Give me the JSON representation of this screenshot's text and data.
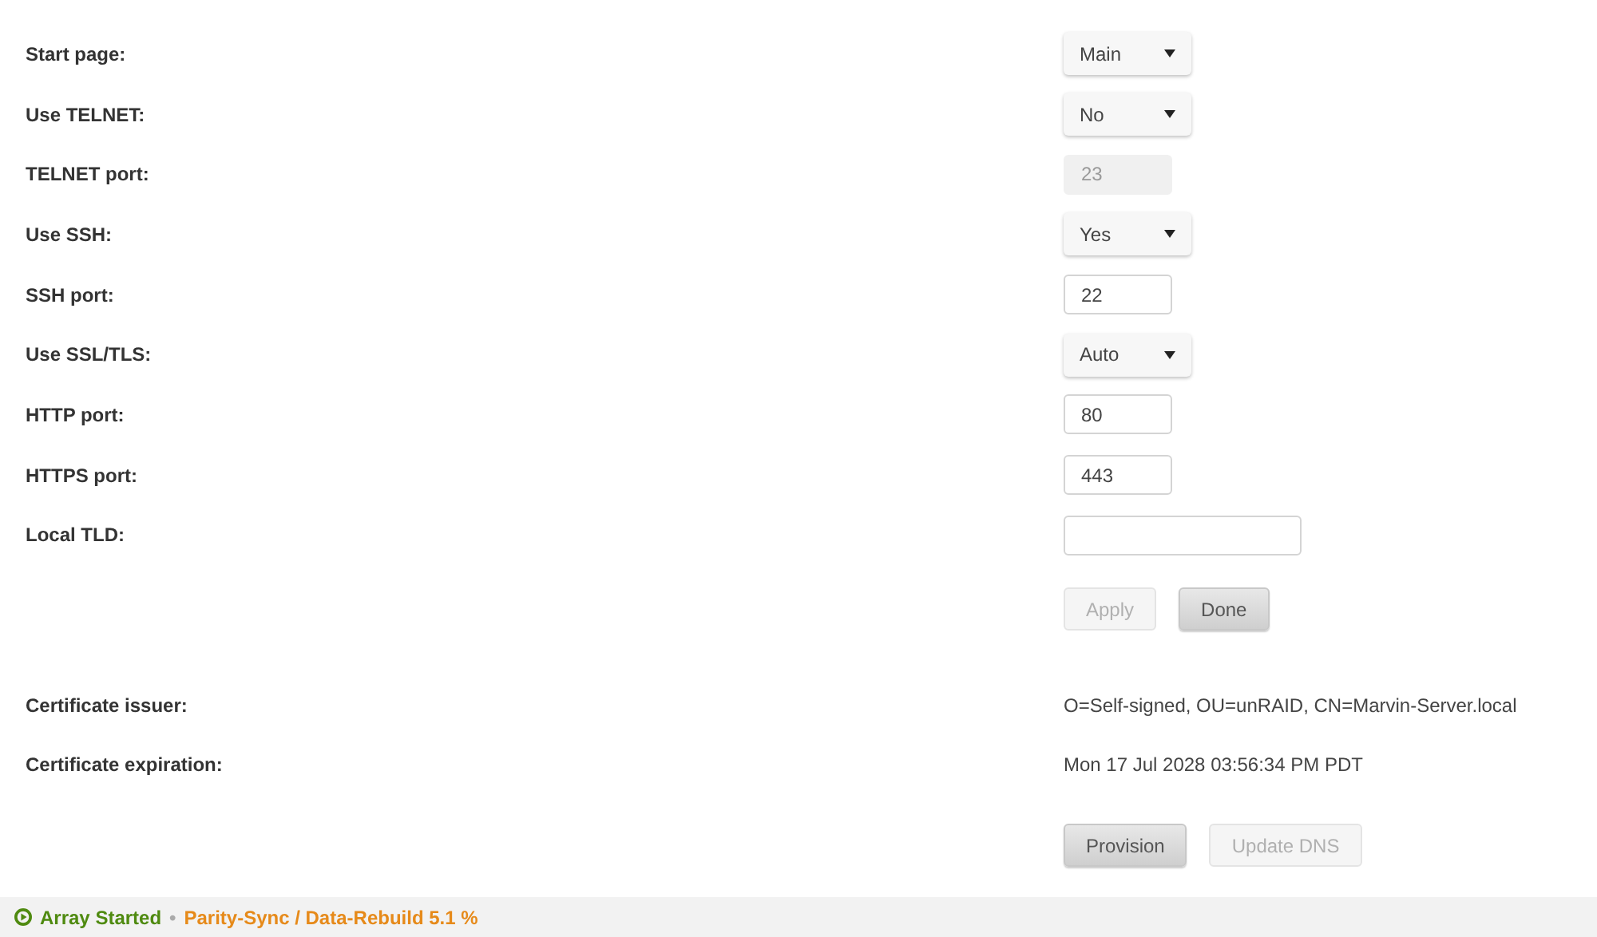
{
  "settings": [
    {
      "label": "Start page:",
      "kind": "select",
      "value": "Main"
    },
    {
      "label": "Use TELNET:",
      "kind": "select",
      "value": "No"
    },
    {
      "label": "TELNET port:",
      "kind": "input",
      "value": "23",
      "disabled": true
    },
    {
      "label": "Use SSH:",
      "kind": "select",
      "value": "Yes"
    },
    {
      "label": "SSH port:",
      "kind": "input",
      "value": "22",
      "disabled": false
    },
    {
      "label": "Use SSL/TLS:",
      "kind": "select",
      "value": "Auto"
    },
    {
      "label": "HTTP port:",
      "kind": "input",
      "value": "80",
      "disabled": false
    },
    {
      "label": "HTTPS port:",
      "kind": "input",
      "value": "443",
      "disabled": false
    },
    {
      "label": "Local TLD:",
      "kind": "text",
      "disabled": false
    }
  ],
  "form_buttons": [
    {
      "label": "Apply",
      "disabled": true
    },
    {
      "label": "Done",
      "disabled": false
    }
  ],
  "certificate": [
    {
      "label": "Certificate issuer:",
      "value": "O=Self-signed, OU=unRAID, CN=Marvin-Server.local"
    },
    {
      "label": "Certificate expiration:",
      "value": "Mon 17 Jul 2028 03:56:34 PM PDT"
    }
  ],
  "certificate_buttons": [
    {
      "label": "Provision",
      "disabled": false
    },
    {
      "label": "Update DNS",
      "disabled": true
    }
  ],
  "status_bar": {
    "array": "Array Started",
    "separator": "•",
    "progress": "Parity-Sync / Data-Rebuild 5.1 %"
  }
}
